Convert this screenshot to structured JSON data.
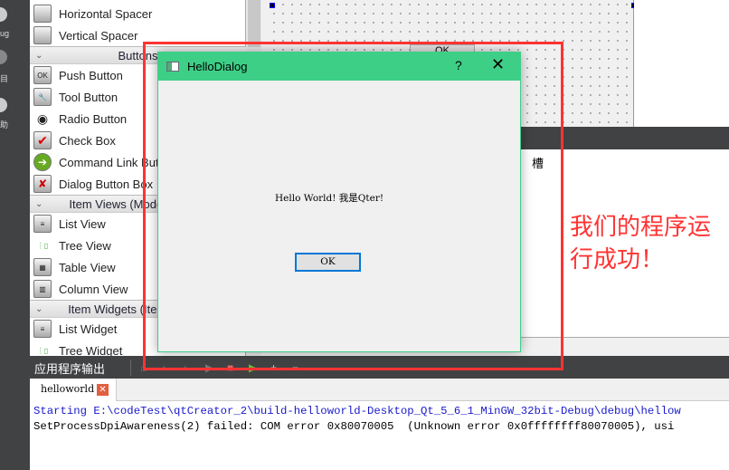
{
  "leftbar": {
    "items": [
      "ug",
      "目",
      "助"
    ]
  },
  "widget_box": {
    "items_top": [
      {
        "label": "Horizontal Spacer",
        "icon": "horizontal-spacer-icon"
      },
      {
        "label": "Vertical Spacer",
        "icon": "vertical-spacer-icon"
      }
    ],
    "categories": [
      {
        "label": "Buttons",
        "items": [
          {
            "label": "Push Button",
            "icon": "ok"
          },
          {
            "label": "Tool Button",
            "icon": "tool"
          },
          {
            "label": "Radio Button",
            "icon": "radio"
          },
          {
            "label": "Check Box",
            "icon": "check"
          },
          {
            "label": "Command Link Button",
            "icon": "arrow"
          },
          {
            "label": "Dialog Button Box",
            "icon": "x"
          }
        ]
      },
      {
        "label": "Item Views (Model-Based)",
        "items": [
          {
            "label": "List View"
          },
          {
            "label": "Tree View"
          },
          {
            "label": "Table View"
          },
          {
            "label": "Column View"
          }
        ]
      },
      {
        "label": "Item Widgets (Item-Based)",
        "items": [
          {
            "label": "List Widget"
          },
          {
            "label": "Tree Widget"
          }
        ]
      }
    ]
  },
  "designer": {
    "ok_label": "OK",
    "slot_header": "槽"
  },
  "dialog": {
    "title": "HelloDialog",
    "help": "?",
    "close": "✕",
    "message": "Hello World! 我是Qter!",
    "ok": "OK",
    "titlebar_color": "#3ecf87"
  },
  "output_pane": {
    "title": "应用程序输出",
    "tab": "helloworld",
    "lines": [
      "Starting E:\\codeTest\\qtCreator_2\\build-helloworld-Desktop_Qt_5_6_1_MinGW_32bit-Debug\\debug\\hellow",
      "SetProcessDpiAwareness(2) failed: COM error 0x80070005  (Unknown error 0x0ffffffff80070005), usi"
    ]
  },
  "annotation": {
    "text": "我们的程序运行成功！",
    "color": "#ff3333"
  }
}
